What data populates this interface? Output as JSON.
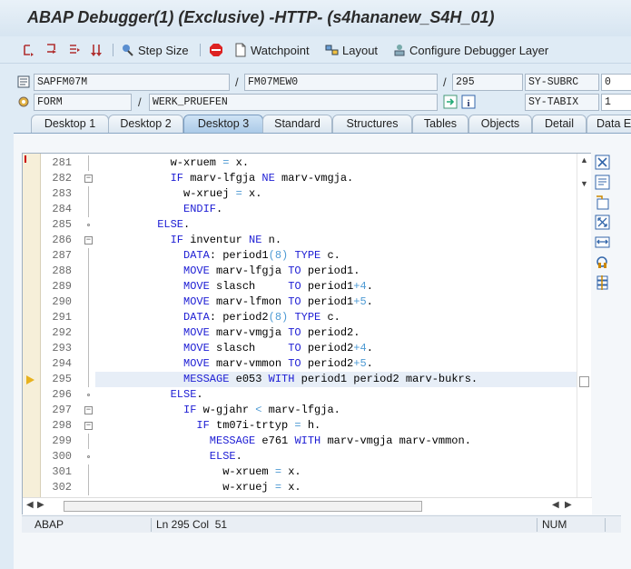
{
  "window": {
    "title": "ABAP Debugger(1)  (Exclusive) -HTTP- (s4hananew_S4H_01)"
  },
  "toolbar": {
    "icons": [
      "single-step-icon",
      "execute-icon",
      "return-icon",
      "continue-icon"
    ],
    "step_size_label": "Step Size",
    "stop_label": "STOP",
    "watchpoint_label": "Watchpoint",
    "layout_label": "Layout",
    "configure_label": "Configure Debugger Layer"
  },
  "context": {
    "program": "SAPFM07M",
    "include": "FM07MEW0",
    "line": "295",
    "sy_subrc_label": "SY-SUBRC",
    "sy_subrc_value": "0",
    "event_type": "FORM",
    "event_name": "WERK_PRUEFEN",
    "sy_tabix_label": "SY-TABIX",
    "sy_tabix_value": "1"
  },
  "tabs": [
    {
      "label": "Desktop 1",
      "active": false
    },
    {
      "label": "Desktop 2",
      "active": false
    },
    {
      "label": "Desktop 3",
      "active": true
    },
    {
      "label": "Standard",
      "active": false
    },
    {
      "label": "Structures",
      "active": false
    },
    {
      "label": "Tables",
      "active": false
    },
    {
      "label": "Objects",
      "active": false
    },
    {
      "label": "Detail",
      "active": false
    },
    {
      "label": "Data E",
      "active": false
    }
  ],
  "source": {
    "current_line": 295,
    "lines": [
      {
        "n": "281",
        "text": "w-xruem = x."
      },
      {
        "n": "282",
        "text": "IF marv-lfgja NE marv-vmgja."
      },
      {
        "n": "283",
        "text": "w-xruej = x."
      },
      {
        "n": "284",
        "text": "ENDIF."
      },
      {
        "n": "285",
        "text": "ELSE."
      },
      {
        "n": "286",
        "text": "IF inventur NE n."
      },
      {
        "n": "287",
        "text": "DATA: period1(8) TYPE c."
      },
      {
        "n": "288",
        "text": "MOVE marv-lfgja TO period1."
      },
      {
        "n": "289",
        "text": "MOVE slasch     TO period1+4."
      },
      {
        "n": "290",
        "text": "MOVE marv-lfmon TO period1+5."
      },
      {
        "n": "291",
        "text": "DATA: period2(8) TYPE c."
      },
      {
        "n": "292",
        "text": "MOVE marv-vmgja TO period2."
      },
      {
        "n": "293",
        "text": "MOVE slasch     TO period2+4."
      },
      {
        "n": "294",
        "text": "MOVE marv-vmmon TO period2+5."
      },
      {
        "n": "295",
        "text": "MESSAGE e053 WITH period1 period2 marv-bukrs."
      },
      {
        "n": "296",
        "text": "ELSE."
      },
      {
        "n": "297",
        "text": "IF w-gjahr < marv-lfgja."
      },
      {
        "n": "298",
        "text": "IF tm07i-trtyp = h."
      },
      {
        "n": "299",
        "text": "MESSAGE e761 WITH marv-vmgja marv-vmmon."
      },
      {
        "n": "300",
        "text": "ELSE."
      },
      {
        "n": "301",
        "text": "w-xruem = x."
      },
      {
        "n": "302",
        "text": "w-xruej = x."
      }
    ]
  },
  "side_tools": [
    "close-window-icon",
    "new-tool-icon",
    "replace-tool-icon",
    "fullscreen-icon",
    "swap-icon",
    "services-icon",
    "settings-icon"
  ],
  "status": {
    "language": "ABAP",
    "position": "Ln 295 Col  51",
    "mode": "NUM"
  }
}
